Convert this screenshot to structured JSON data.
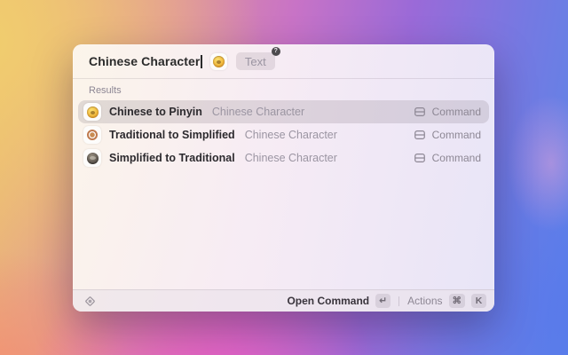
{
  "window": {
    "search": {
      "value": "Chinese Character",
      "tag": "Text",
      "tag_badge": "?"
    },
    "results": {
      "header": "Results",
      "items": [
        {
          "title": "Chinese to Pinyin",
          "subtitle": "Chinese Character",
          "type": "Command",
          "icon": "gold-circle-extension-icon"
        },
        {
          "title": "Traditional to Simplified",
          "subtitle": "Chinese Character",
          "type": "Command",
          "icon": "orange-ring-extension-icon"
        },
        {
          "title": "Simplified to Traditional",
          "subtitle": "Chinese Character",
          "type": "Command",
          "icon": "dark-stamp-extension-icon"
        }
      ]
    },
    "footer": {
      "primary_action": "Open Command",
      "primary_key": "↵",
      "actions_label": "Actions",
      "actions_key_1": "⌘",
      "actions_key_2": "K"
    }
  },
  "colors": {
    "accent_gold": "#f2b93c",
    "selection": "#d9d2d8",
    "wallpaper_left": "#ecbb72",
    "wallpaper_magenta": "#ee58c6",
    "wallpaper_right": "#5c86e8"
  }
}
